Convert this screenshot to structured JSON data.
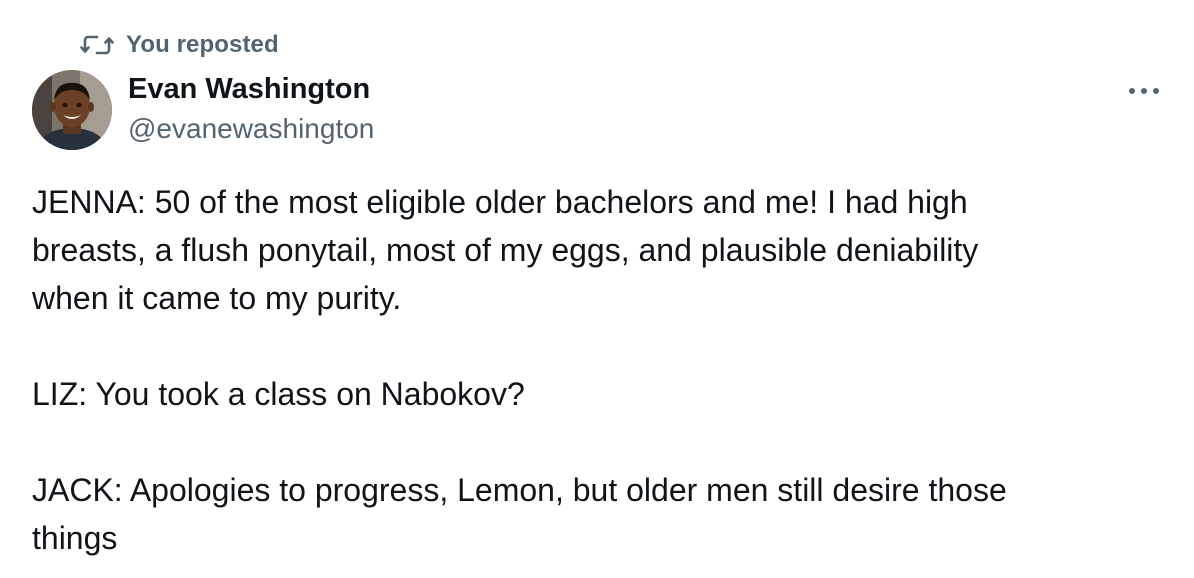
{
  "repost": {
    "icon": "repost-icon",
    "label": "You reposted"
  },
  "author": {
    "name": "Evan Washington",
    "handle": "@evanewashington",
    "avatar": "avatar"
  },
  "more_icon": "more-horizontal-icon",
  "body": {
    "line1a": "JENNA: 50 of the most eligible older bachelors and me! I had high",
    "line1b": "breasts, a flush ponytail, most of my eggs, and plausible deniability",
    "line1c": "when it came to my purity.",
    "line2": "LIZ: You took a class on Nabokov?",
    "line3a": "JACK: Apologies to progress, Lemon, but older men still desire those",
    "line3b": "things"
  },
  "colors": {
    "text": "#0f1419",
    "secondary": "#536471",
    "background": "#ffffff"
  }
}
